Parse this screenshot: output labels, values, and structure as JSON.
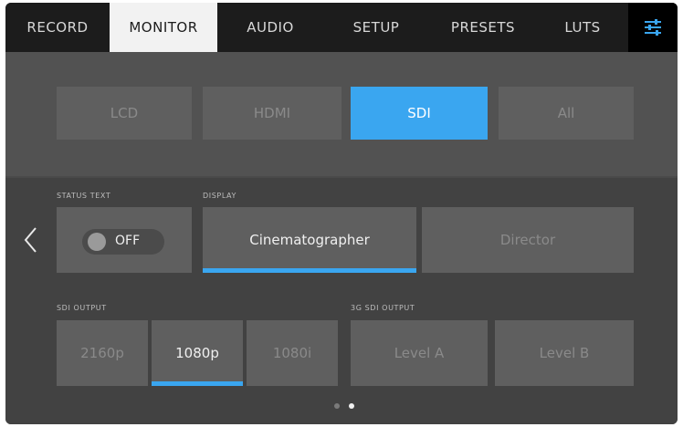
{
  "tabs": [
    {
      "label": "RECORD"
    },
    {
      "label": "MONITOR"
    },
    {
      "label": "AUDIO"
    },
    {
      "label": "SETUP"
    },
    {
      "label": "PRESETS"
    },
    {
      "label": "LUTS"
    }
  ],
  "settings_icon": "sliders-icon",
  "output_buttons": [
    {
      "label": "LCD"
    },
    {
      "label": "HDMI"
    },
    {
      "label": "SDI"
    },
    {
      "label": "All"
    }
  ],
  "status_text": {
    "label": "STATUS TEXT",
    "toggle_value": "OFF"
  },
  "display": {
    "label": "DISPLAY",
    "options": [
      "Cinematographer",
      "Director"
    ]
  },
  "sdi_output": {
    "label": "SDI OUTPUT",
    "options": [
      "2160p",
      "1080p",
      "1080i"
    ]
  },
  "threeg_sdi_output": {
    "label": "3G SDI OUTPUT",
    "options": [
      "Level A",
      "Level B"
    ]
  },
  "colors": {
    "accent": "#3aa6f0"
  }
}
